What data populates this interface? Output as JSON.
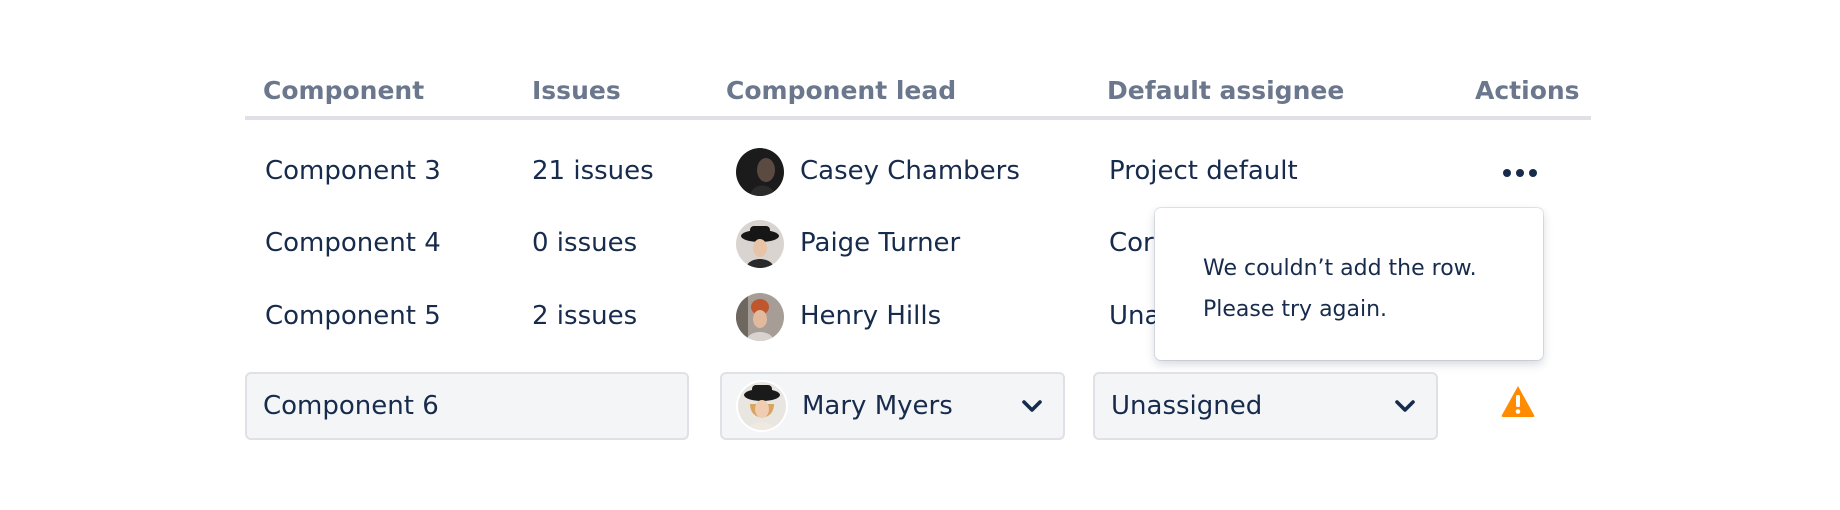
{
  "table": {
    "headers": {
      "component": "Component",
      "issues": "Issues",
      "lead": "Component lead",
      "assignee": "Default assignee",
      "actions": "Actions"
    },
    "rows": [
      {
        "component": "Component 3",
        "issues": "21 issues",
        "lead": "Casey Chambers",
        "assignee": "Project default"
      },
      {
        "component": "Component 4",
        "issues": "0 issues",
        "lead": "Paige Turner",
        "assignee": "Cor"
      },
      {
        "component": "Component 5",
        "issues": "2 issues",
        "lead": "Henry Hills",
        "assignee": "Una"
      }
    ]
  },
  "error_popup": {
    "line1": "We couldn’t add the row.",
    "line2": "Please try again."
  },
  "new_row": {
    "component_value": "Component 6",
    "lead_value": "Mary Myers",
    "assignee_value": "Unassigned"
  },
  "icons": {
    "more": "more-horizontal-icon",
    "chevron": "chevron-down-icon",
    "warning": "warning-icon"
  },
  "colors": {
    "text": "#172b4d",
    "header_text": "#6b778c",
    "rule": "#dfe1e6",
    "field_bg": "#f4f5f7",
    "warning": "#ff8b00"
  }
}
